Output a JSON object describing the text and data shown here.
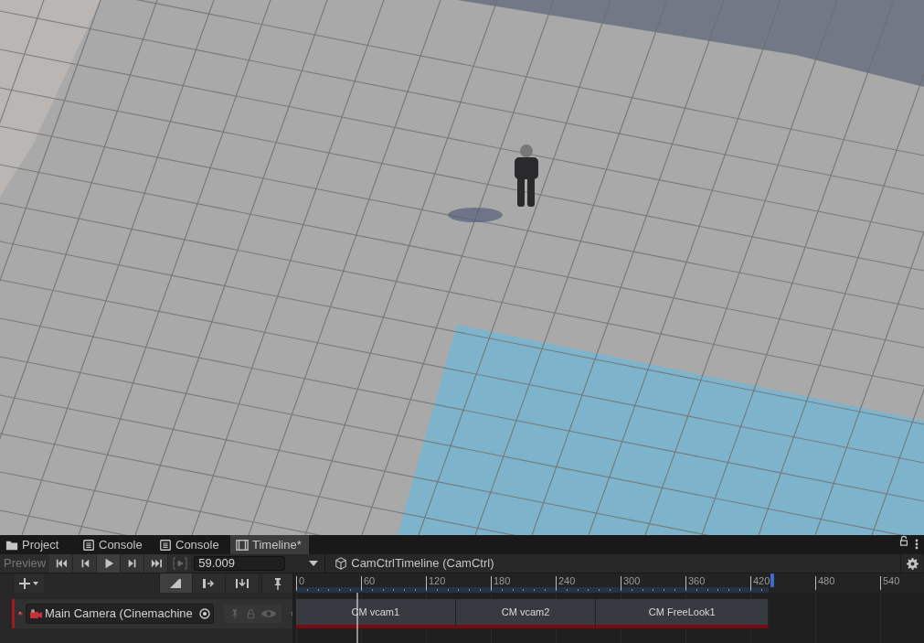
{
  "tabs": [
    {
      "label": "Project",
      "kind": "folder",
      "selected": false
    },
    {
      "label": "Console",
      "kind": "console",
      "selected": false
    },
    {
      "label": "Console",
      "kind": "console",
      "selected": false
    },
    {
      "label": "Timeline*",
      "kind": "film",
      "selected": true
    }
  ],
  "toolbar": {
    "preview": {
      "label": "Preview",
      "on": false
    },
    "time": "59.009",
    "playable": "CamCtrlTimeline (CamCtrl)"
  },
  "ruler": {
    "labels": [
      "0",
      "60",
      "120",
      "180",
      "240",
      "300",
      "360",
      "420",
      "480",
      "540"
    ]
  },
  "track": {
    "name": "Main Camera (Cinemachine"
  },
  "clips": [
    {
      "label": "CM vcam1"
    },
    {
      "label": "CM vcam2"
    },
    {
      "label": "CM FreeLook1"
    }
  ]
}
